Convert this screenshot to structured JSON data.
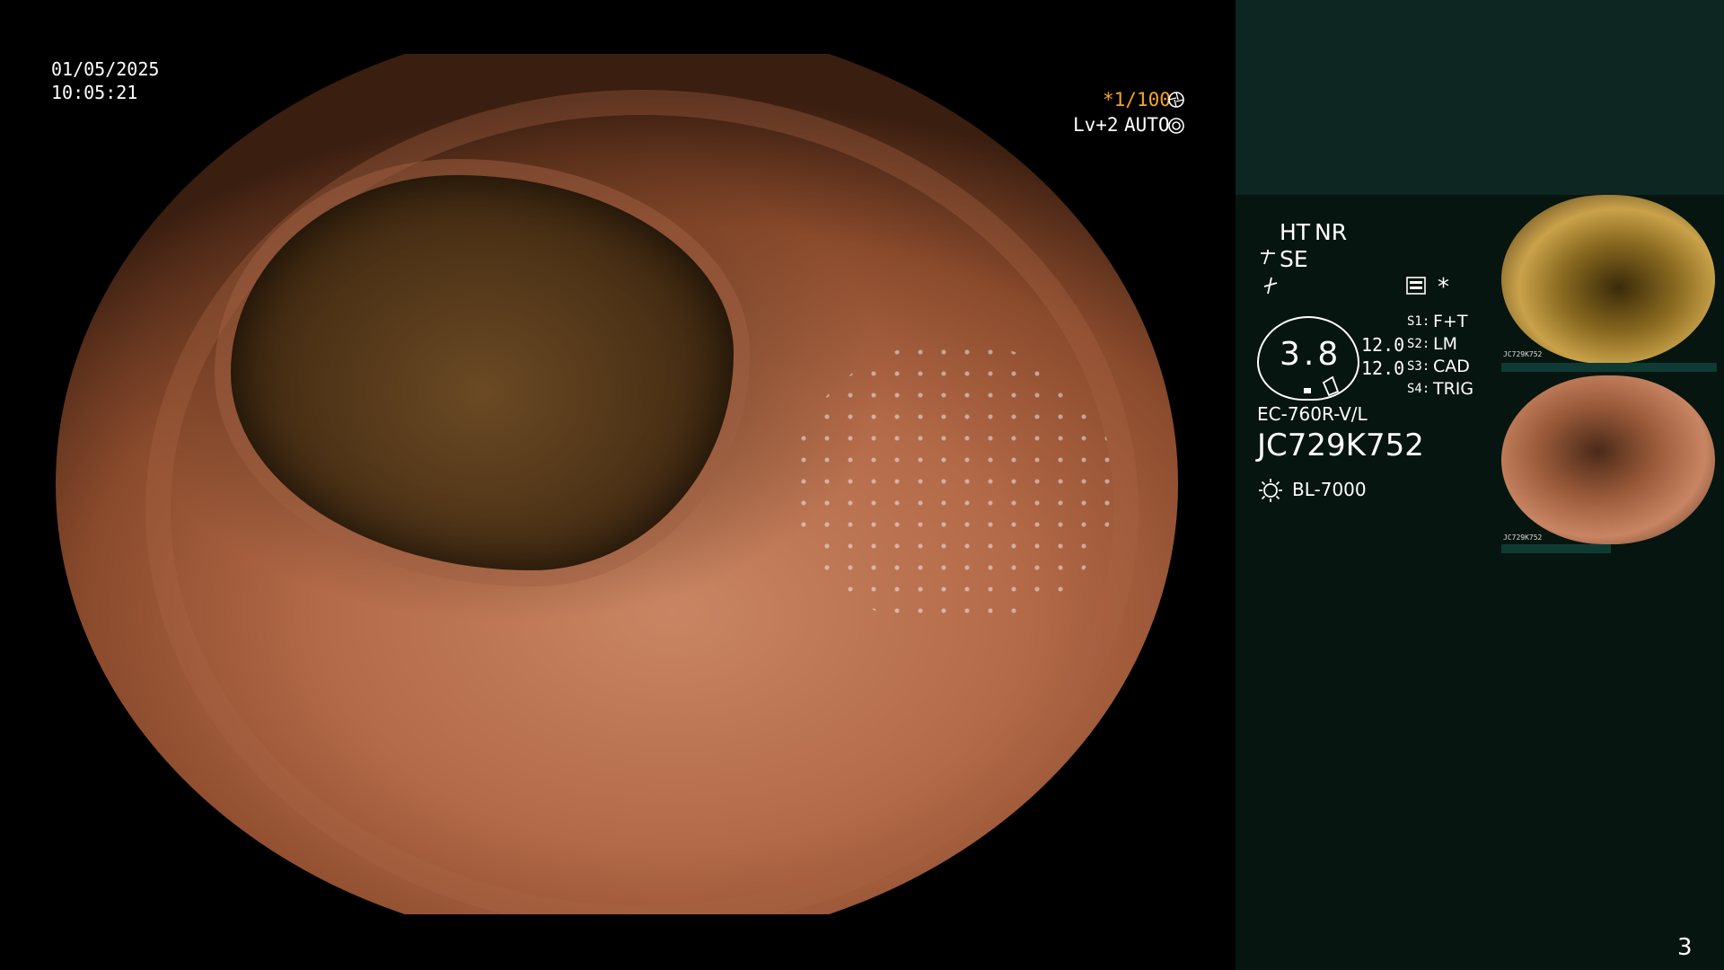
{
  "datetime": {
    "date": "01/05/2025",
    "time": "10:05:21"
  },
  "status": {
    "shutter": "*1/100",
    "level": "Lv+2",
    "auto": "AUTO"
  },
  "settings": {
    "ht": "HT",
    "nr": "NR",
    "se": "SE",
    "asterisk": "*"
  },
  "gauge": {
    "value": "3.8",
    "top": "12.0",
    "bottom": "12.0"
  },
  "switches": [
    {
      "key": "S1:",
      "value": "F+T"
    },
    {
      "key": "S2:",
      "value": "LM"
    },
    {
      "key": "S3:",
      "value": "CAD"
    },
    {
      "key": "S4:",
      "value": "TRIG"
    }
  ],
  "scope": {
    "model": "EC-760R-V/L",
    "serial": "JC729K752"
  },
  "light_source": "BL-7000",
  "thumbnails": [
    {
      "serial": "JC729K752"
    },
    {
      "serial": "JC729K752"
    }
  ],
  "page_number": "3",
  "colors": {
    "accent": "#f5a623",
    "panel": "#06150f",
    "panel_top": "#0e2622"
  }
}
